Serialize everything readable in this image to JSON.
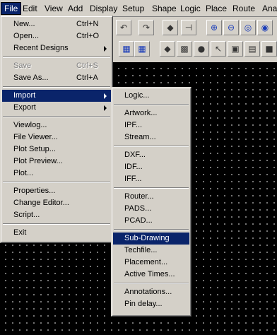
{
  "menubar": {
    "items": [
      "File",
      "Edit",
      "View",
      "Add",
      "Display",
      "Setup",
      "Shape",
      "Logic",
      "Place",
      "Route",
      "Anal"
    ]
  },
  "toolbar": {
    "icons": [
      "undo-icon",
      "redo-icon",
      "cross-probe-icon",
      "pin-icon",
      "zoom-in-icon",
      "zoom-out-icon",
      "zoom-fit-icon",
      "zoom-previous-icon",
      "zoom-world-icon",
      "grid-icon",
      "circle-icon",
      "select-icon",
      "move-icon",
      "stop-icon"
    ]
  },
  "file_menu": {
    "items": [
      {
        "label": "New...",
        "shortcut": "Ctrl+N"
      },
      {
        "label": "Open...",
        "shortcut": "Ctrl+O"
      },
      {
        "label": "Recent Designs"
      },
      {
        "label": "Save",
        "shortcut": "Ctrl+S"
      },
      {
        "label": "Save As...",
        "shortcut": "Ctrl+A"
      },
      {
        "label": "Import"
      },
      {
        "label": "Export"
      },
      {
        "label": "Viewlog..."
      },
      {
        "label": "File Viewer..."
      },
      {
        "label": "Plot Setup..."
      },
      {
        "label": "Plot Preview..."
      },
      {
        "label": "Plot..."
      },
      {
        "label": "Properties..."
      },
      {
        "label": "Change Editor..."
      },
      {
        "label": "Script..."
      },
      {
        "label": "Exit"
      }
    ]
  },
  "import_menu": {
    "items": [
      {
        "label": "Logic..."
      },
      {
        "label": "Artwork..."
      },
      {
        "label": "IPF..."
      },
      {
        "label": "Stream..."
      },
      {
        "label": "DXF..."
      },
      {
        "label": "IDF..."
      },
      {
        "label": "IFF..."
      },
      {
        "label": "Router..."
      },
      {
        "label": "PADS..."
      },
      {
        "label": "PCAD..."
      },
      {
        "label": "Sub-Drawing"
      },
      {
        "label": "Techfile..."
      },
      {
        "label": "Placement..."
      },
      {
        "label": "Active Times..."
      },
      {
        "label": "Annotations..."
      },
      {
        "label": "Pin delay..."
      }
    ]
  },
  "colors": {
    "highlight": "#0a246a",
    "menu_bg": "#d4d0c8",
    "canvas_bg": "#000000",
    "grid_dot": "#9a9a9a"
  }
}
